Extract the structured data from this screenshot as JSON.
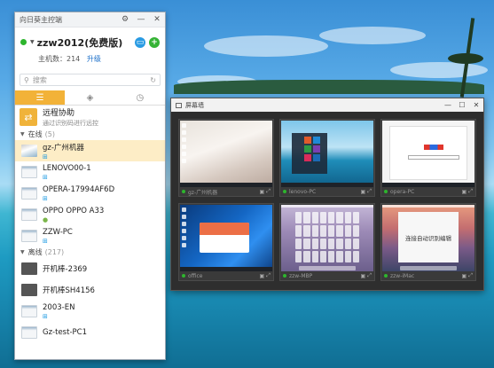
{
  "app": {
    "title": "向日葵主控端",
    "username": "zzw2012(免费版)",
    "host_count_label": "主机数：214",
    "upgrade_label": "升级",
    "search_placeholder": "搜索",
    "tabs": [
      {
        "icon": "list-icon",
        "active": true
      },
      {
        "icon": "tag-icon",
        "active": false
      },
      {
        "icon": "clock-icon",
        "active": false
      }
    ],
    "assist": {
      "title": "远程协助",
      "subtitle": "通过识别码进行远控"
    },
    "online_group": {
      "label": "在线",
      "count": "(5)"
    },
    "online_hosts": [
      {
        "name": "gz-广州机器",
        "os": "windows"
      },
      {
        "name": "LENOVO00-1",
        "os": "windows"
      },
      {
        "name": "OPERA-17994AF6D",
        "os": "windows"
      },
      {
        "name": "OPPO OPPO A33",
        "os": "android"
      },
      {
        "name": "ZZW-PC",
        "os": "windows"
      }
    ],
    "offline_group": {
      "label": "离线",
      "count": "(217)"
    },
    "offline_hosts": [
      {
        "name": "开机棒-2369"
      },
      {
        "name": "开机棒SH4156"
      },
      {
        "name": "2003-EN"
      },
      {
        "name": "Gz-test-PC1"
      }
    ]
  },
  "viewer": {
    "title": "屏幕墙",
    "screens": [
      {
        "caption": "gz-广州机器"
      },
      {
        "caption": "lenovo-PC"
      },
      {
        "caption": "opera-PC"
      },
      {
        "caption": "office"
      },
      {
        "caption": "zzw-MBP"
      },
      {
        "caption": "zzw-iMac",
        "content_text": "连接自动识别编辑"
      }
    ]
  },
  "colors": {
    "accent": "#f2b238",
    "online": "#2db52d",
    "link": "#1b6fc9",
    "windows": "#1d9ae2",
    "android": "#7bb64a"
  }
}
